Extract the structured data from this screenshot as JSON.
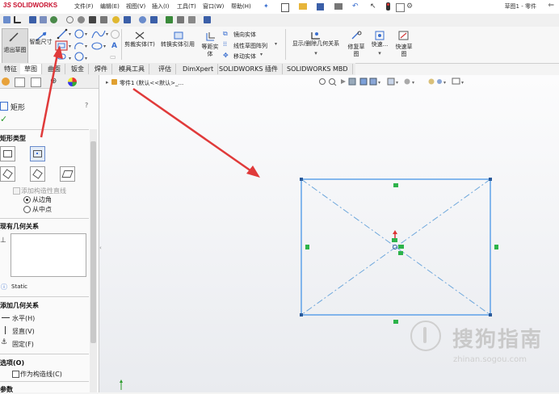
{
  "app": {
    "logo_prefix": "3S",
    "logo_text": "SOLIDWORKS",
    "document_title": "草图1 - 零件",
    "menu": [
      "文件(F)",
      "编辑(E)",
      "视图(V)",
      "插入(I)",
      "工具(T)",
      "窗口(W)",
      "帮助(H)"
    ]
  },
  "command_manager": {
    "exit_sketch": "退出草图",
    "smart_dimension": "智能尺寸",
    "trim_entities": "剪裁实体(T)",
    "convert_entities": "转换实体引用",
    "offset_entities_l1": "等距实",
    "offset_entities_l2": "体",
    "mirror_entities": "镜向实体",
    "linear_pattern": "线性草图阵列",
    "move_entities": "移动实体",
    "display_relations": "显示/删除几何关系",
    "repair_sketch_l1": "修复草",
    "repair_sketch_l2": "图",
    "quick_snaps": "快速...",
    "rapid_sketch_l1": "快速草",
    "rapid_sketch_l2": "图"
  },
  "tabs": [
    "特征",
    "草图",
    "曲面",
    "钣金",
    "焊件",
    "模具工具",
    "评估",
    "DimXpert",
    "SOLIDWORKS 插件",
    "SOLIDWORKS MBD"
  ],
  "active_tab": 1,
  "panel": {
    "title": "矩形",
    "rect_type_header": "矩形类型",
    "add_construction_lines": "添加构造性直线",
    "from_corner": "从边角",
    "from_midpoint": "从中点",
    "existing_relations_header": "现有几何关系",
    "static_label": "Static",
    "add_relations_header": "添加几何关系",
    "horizontal": "水平(H)",
    "vertical": "竖直(V)",
    "fix": "固定(F)",
    "options_header": "选项(O)",
    "as_construction": "作为构造线(C)",
    "params_header": "参数"
  },
  "canvas": {
    "breadcrumb": "零件1 (默认<<默认>_..."
  },
  "watermark": {
    "text": "搜狗指南",
    "url": "zhinan.sogou.com"
  },
  "colors": {
    "sketch_line": "#3a8ee6",
    "construction_line": "#6fa8dc",
    "relation_badge": "#2db34a",
    "arrow": "#e03a3a",
    "logo_red": "#c8102e"
  }
}
